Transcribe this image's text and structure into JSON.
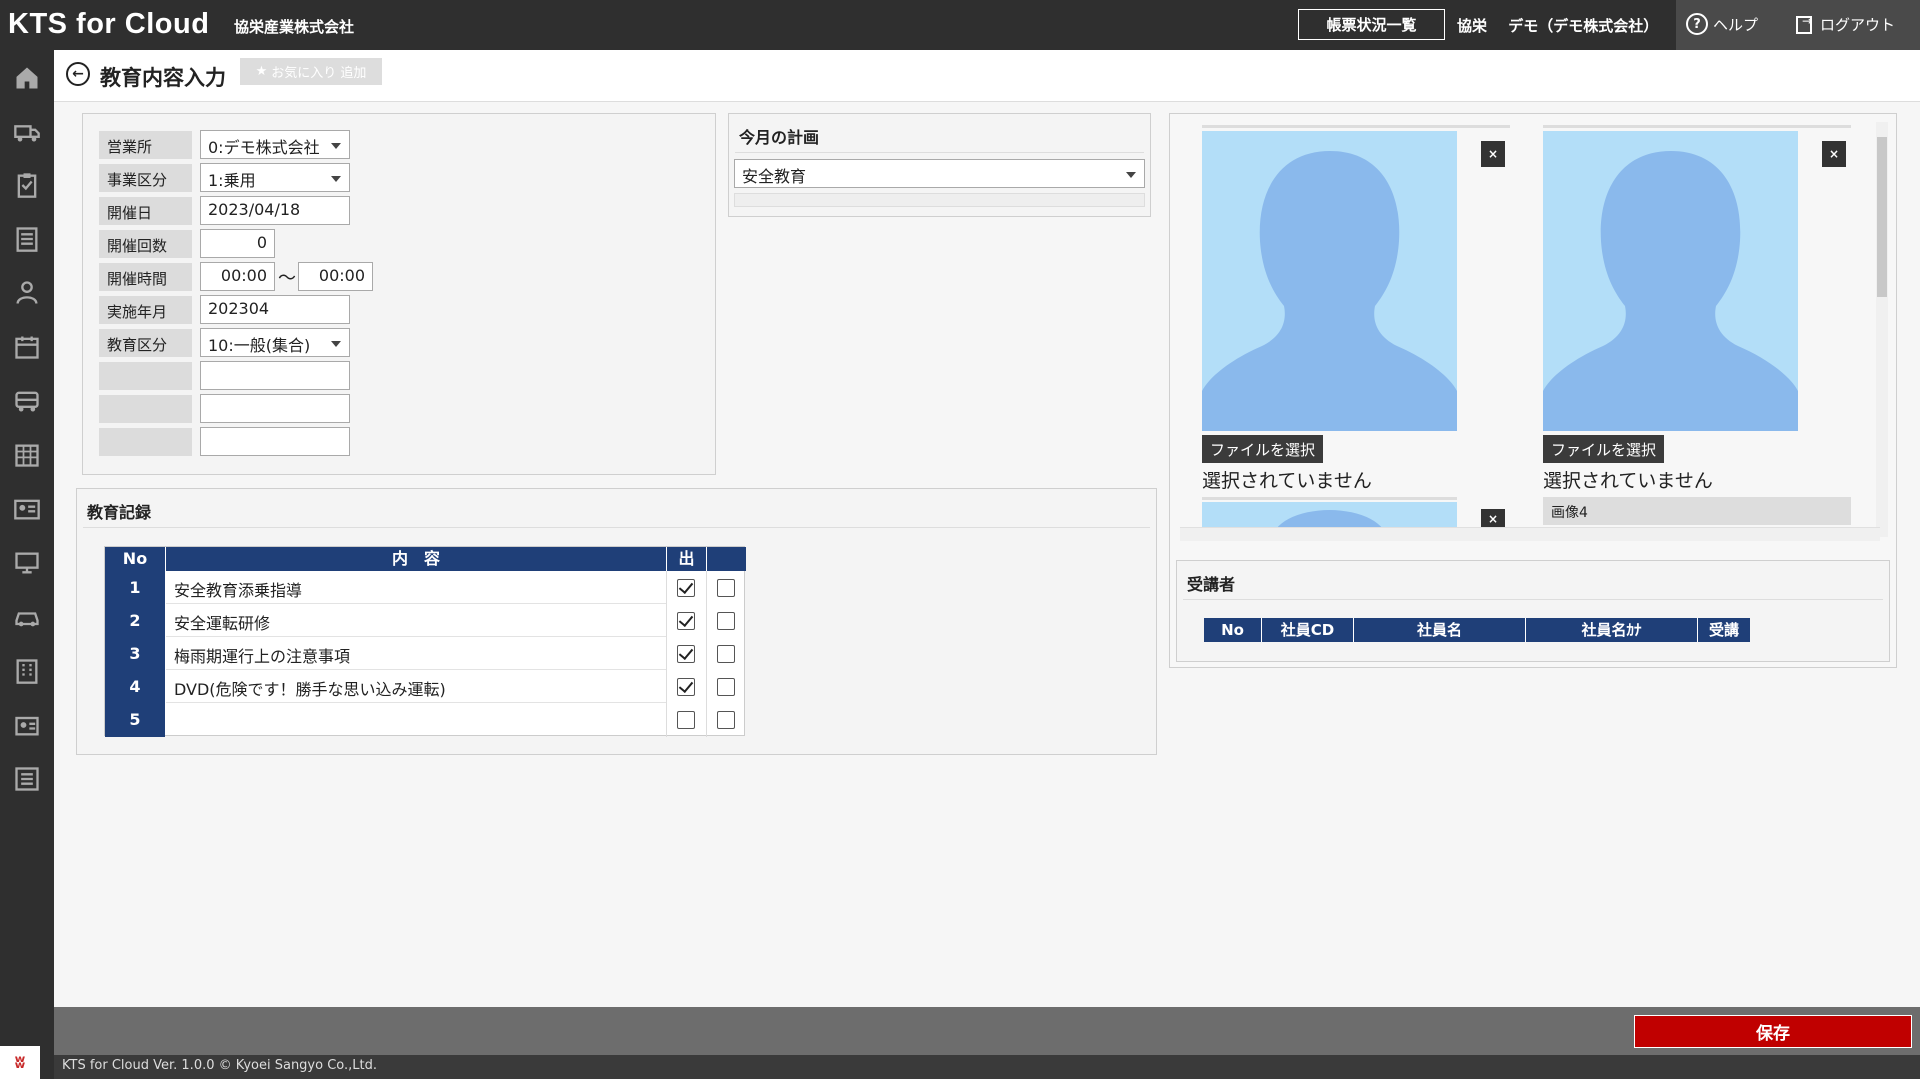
{
  "header": {
    "brand": "KTS for Cloud",
    "company": "協栄産業株式会社",
    "report_button": "帳票状況一覧",
    "user_short": "協栄",
    "user_org": "デモ（デモ株式会社）",
    "help": "ヘルプ",
    "logout": "ログアウト"
  },
  "sidebar": {
    "items": [
      "home-icon",
      "truck-icon",
      "clipboard-icon",
      "document-icon",
      "person-icon",
      "calendar-icon",
      "bus-icon",
      "calendar-grid-icon",
      "id-card-icon",
      "monitor-icon",
      "car-icon",
      "building-icon",
      "badge-icon",
      "list-icon"
    ]
  },
  "title": {
    "text": "教育内容入力",
    "favorite": "お気に入り 追加"
  },
  "form": {
    "rows": [
      {
        "label": "営業所",
        "value": "0:デモ株式会社"
      },
      {
        "label": "事業区分",
        "value": "1:乗用"
      },
      {
        "label": "開催日",
        "value": "2023/04/18"
      },
      {
        "label": "開催回数",
        "value": "0"
      },
      {
        "label": "開催時間",
        "value": "00:00",
        "value2": "00:00",
        "separator": "〜"
      },
      {
        "label": "実施年月",
        "value": "202304"
      },
      {
        "label": "教育区分",
        "value": "10:一般(集合)"
      },
      {
        "label": "",
        "value": ""
      },
      {
        "label": "",
        "value": ""
      },
      {
        "label": "",
        "value": ""
      }
    ]
  },
  "plan": {
    "title": "今月の計画",
    "value": "安全教育"
  },
  "record": {
    "title": "教育記録",
    "headers": {
      "no": "No",
      "content": "内　容",
      "attend": "出"
    },
    "rows": [
      {
        "no": "1",
        "content": "安全教育添乗指導",
        "c1": true,
        "c2": false
      },
      {
        "no": "2",
        "content": "安全運転研修",
        "c1": true,
        "c2": false
      },
      {
        "no": "3",
        "content": "梅雨期運行上の注意事項",
        "c1": true,
        "c2": false
      },
      {
        "no": "4",
        "content": "DVD(危険です！勝手な思い込み運転)",
        "c1": true,
        "c2": false
      },
      {
        "no": "5",
        "content": "",
        "c1": false,
        "c2": false
      }
    ]
  },
  "photos": {
    "items": [
      {
        "button": "ファイルを選択",
        "status": "選択されていません"
      },
      {
        "button": "ファイルを選択",
        "status": "選択されていません"
      }
    ],
    "image4_label": "画像4",
    "close": "×"
  },
  "attendees": {
    "title": "受講者",
    "headers": [
      "No",
      "社員CD",
      "社員名",
      "社員名ｶﾅ",
      "受講"
    ]
  },
  "footer": {
    "save": "保存",
    "copyright": "KTS for Cloud Ver. 1.0.0 © Kyoei Sangyo Co.,Ltd."
  }
}
